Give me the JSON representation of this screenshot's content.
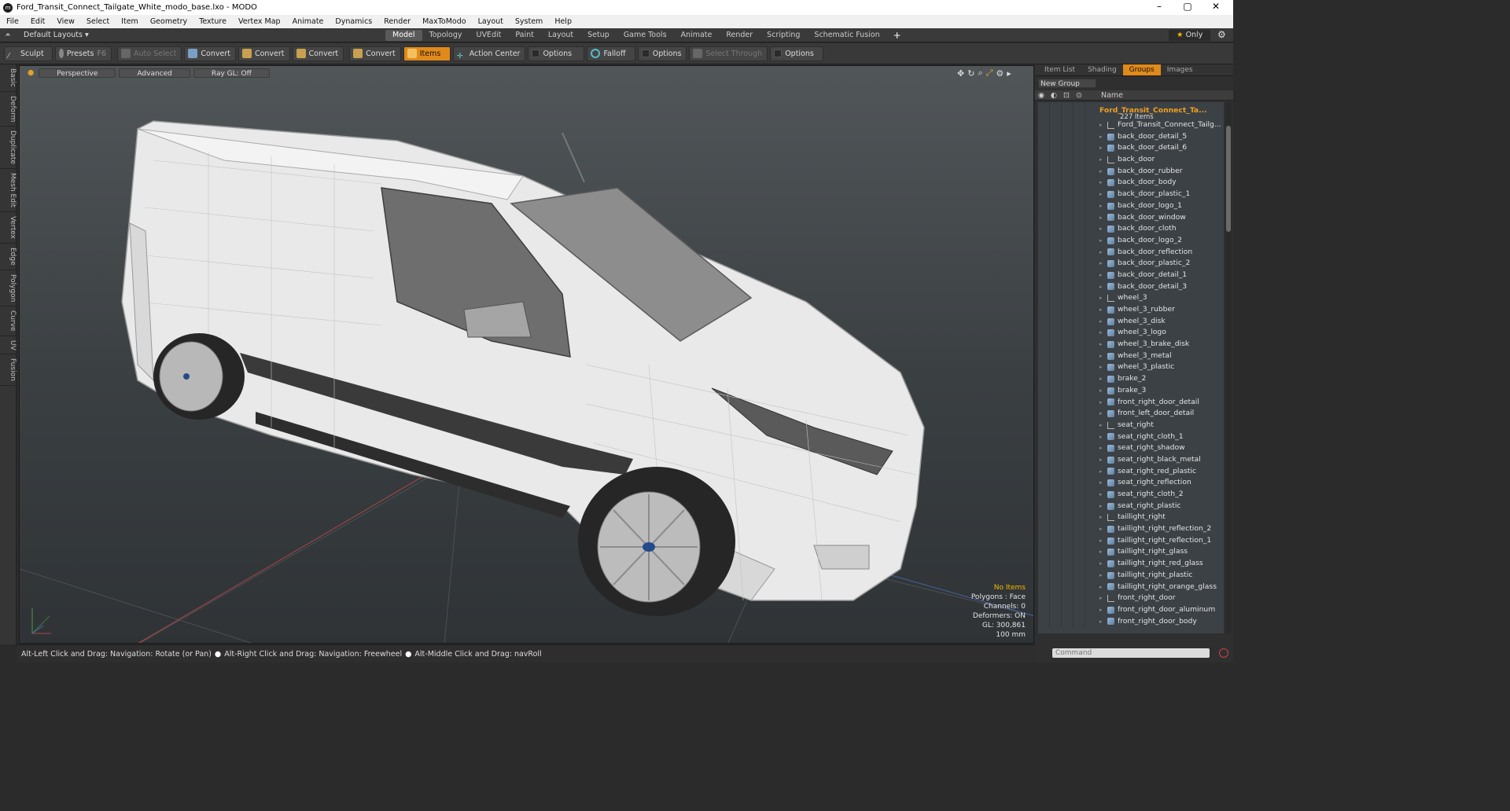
{
  "window": {
    "title": "Ford_Transit_Connect_Tailgate_White_modo_base.lxo - MODO",
    "logo": "modo-logo"
  },
  "menu": [
    "File",
    "Edit",
    "View",
    "Select",
    "Item",
    "Geometry",
    "Texture",
    "Vertex Map",
    "Animate",
    "Dynamics",
    "Render",
    "MaxToModo",
    "Layout",
    "System",
    "Help"
  ],
  "layouts": {
    "label": "Default Layouts ▾",
    "only": "Only"
  },
  "tabs": [
    "Model",
    "Topology",
    "UVEdit",
    "Paint",
    "Layout",
    "Setup",
    "Game Tools",
    "Animate",
    "Render",
    "Scripting",
    "Schematic Fusion"
  ],
  "toolbar": {
    "sculpt": "Sculpt",
    "presets": "Presets",
    "presets_key": "F6",
    "auto_select": "Auto Select",
    "convert": "Convert",
    "items": "Items",
    "action_center": "Action Center",
    "options": "Options",
    "falloff": "Falloff",
    "select_through": "Select Through"
  },
  "left_tabs": [
    "Basic",
    "Deform",
    "Duplicate",
    "Mesh Edit",
    "Vertex",
    "Edge",
    "Polygon",
    "Curve",
    "UV",
    "Fusion"
  ],
  "viewport": {
    "perspective": "Perspective",
    "advanced": "Advanced",
    "raygl": "Ray GL: Off",
    "stats": {
      "items": "No Items",
      "polygons": "Polygons : Face",
      "channels": "Channels: 0",
      "deformers": "Deformers: ON",
      "gl": "GL: 300,861",
      "scale": "100 mm"
    }
  },
  "status": {
    "hint1": "Alt-Left Click and Drag: Navigation: Rotate (or Pan)",
    "hint2": "Alt-Right Click and Drag: Navigation: Freewheel",
    "hint3": "Alt-Middle Click and Drag: navRoll"
  },
  "panel": {
    "tabs": [
      "Item List",
      "Shading",
      "Groups",
      "Images"
    ],
    "new_group": "New Group",
    "name_col": "Name",
    "group_name": "Ford_Transit_Connect_Ta...",
    "group_count": "227 Items",
    "items": [
      "Ford_Transit_Connect_Tailg...",
      "back_door_detail_5",
      "back_door_detail_6",
      "back_door",
      "back_door_rubber",
      "back_door_body",
      "back_door_plastic_1",
      "back_door_logo_1",
      "back_door_window",
      "back_door_cloth",
      "back_door_logo_2",
      "back_door_reflection",
      "back_door_plastic_2",
      "back_door_detail_1",
      "back_door_detail_3",
      "wheel_3",
      "wheel_3_rubber",
      "wheel_3_disk",
      "wheel_3_logo",
      "wheel_3_brake_disk",
      "wheel_3_metal",
      "wheel_3_plastic",
      "brake_2",
      "brake_3",
      "front_right_door_detail",
      "front_left_door_detail",
      "seat_right",
      "seat_right_cloth_1",
      "seat_right_shadow",
      "seat_right_black_metal",
      "seat_right_red_plastic",
      "seat_right_reflection",
      "seat_right_cloth_2",
      "seat_right_plastic",
      "taillight_right",
      "taillight_right_reflection_2",
      "taillight_right_reflection_1",
      "taillight_right_glass",
      "taillight_right_red_glass",
      "taillight_right_plastic",
      "taillight_right_orange_glass",
      "front_right_door",
      "front_right_door_aluminum",
      "front_right_door_body"
    ],
    "locators": [
      0,
      3,
      15,
      26,
      34,
      41
    ],
    "command_placeholder": "Command"
  }
}
